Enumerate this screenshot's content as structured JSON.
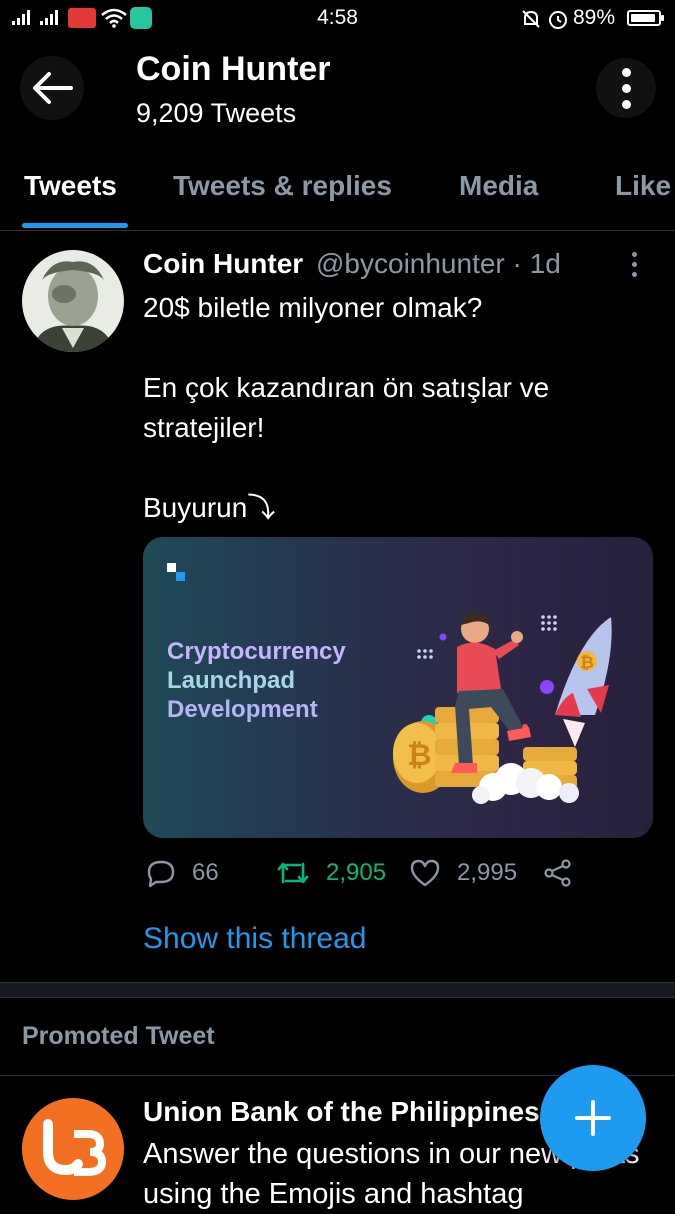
{
  "status_bar": {
    "time": "4:58",
    "battery": "89%",
    "battery_level": 0.89
  },
  "header": {
    "title": "Coin Hunter",
    "subtitle": "9,209 Tweets"
  },
  "tabs": [
    {
      "label": "Tweets",
      "active": true
    },
    {
      "label": "Tweets & replies",
      "active": false
    },
    {
      "label": "Media",
      "active": false
    },
    {
      "label": "Like",
      "active": false
    }
  ],
  "tweet": {
    "author_name": "Coin Hunter",
    "handle_time": "@bycoinhunter · 1d",
    "lines": [
      "20$ biletle milyoner olmak?",
      "",
      "En çok kazandıran ön satışlar ve stratejiler!",
      "",
      "Buyurun⤵"
    ],
    "media": {
      "title_line1": "Cryptocurrency",
      "title_line2": "Launchpad",
      "title_line3": "Development"
    },
    "reply_count": "66",
    "retweet_count": "2,905",
    "like_count": "2,995",
    "thread_link": "Show this thread"
  },
  "promoted": {
    "label": "Promoted Tweet",
    "author_name": "Union Bank of the Philippines",
    "text": "Answer the questions in our new posts using the Emojis and hashtag"
  },
  "colors": {
    "accent": "#1d9bf0",
    "retweet": "#00ba7c",
    "muted": "#8b98a5",
    "union_bank": "#f36f21"
  }
}
